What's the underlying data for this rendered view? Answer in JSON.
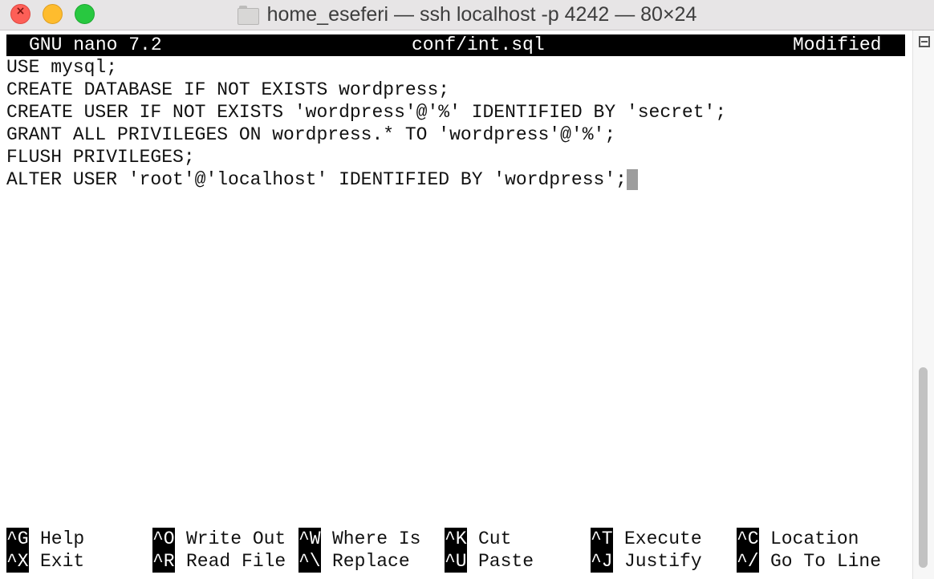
{
  "window": {
    "title": "home_eseferi — ssh localhost -p 4242 — 80×24",
    "icon": "folder-icon"
  },
  "nano": {
    "version": "GNU nano 7.2",
    "filename": "conf/int.sql",
    "status": "Modified",
    "lines": [
      "USE mysql;",
      "CREATE DATABASE IF NOT EXISTS wordpress;",
      "CREATE USER IF NOT EXISTS 'wordpress'@'%' IDENTIFIED BY 'secret';",
      "GRANT ALL PRIVILEGES ON wordpress.* TO 'wordpress'@'%';",
      "FLUSH PRIVILEGES;",
      "ALTER USER 'root'@'localhost' IDENTIFIED BY 'wordpress';"
    ],
    "shortcuts": [
      {
        "key": "^G",
        "label": "Help"
      },
      {
        "key": "^O",
        "label": "Write Out"
      },
      {
        "key": "^W",
        "label": "Where Is"
      },
      {
        "key": "^K",
        "label": "Cut"
      },
      {
        "key": "^T",
        "label": "Execute"
      },
      {
        "key": "^C",
        "label": "Location"
      },
      {
        "key": "^X",
        "label": "Exit"
      },
      {
        "key": "^R",
        "label": "Read File"
      },
      {
        "key": "^\\",
        "label": "Replace"
      },
      {
        "key": "^U",
        "label": "Paste"
      },
      {
        "key": "^J",
        "label": "Justify"
      },
      {
        "key": "^/",
        "label": "Go To Line"
      }
    ]
  },
  "colors": {
    "header_bg": "#000000",
    "header_fg": "#ffffff",
    "cursor": "#9d9d9d"
  }
}
